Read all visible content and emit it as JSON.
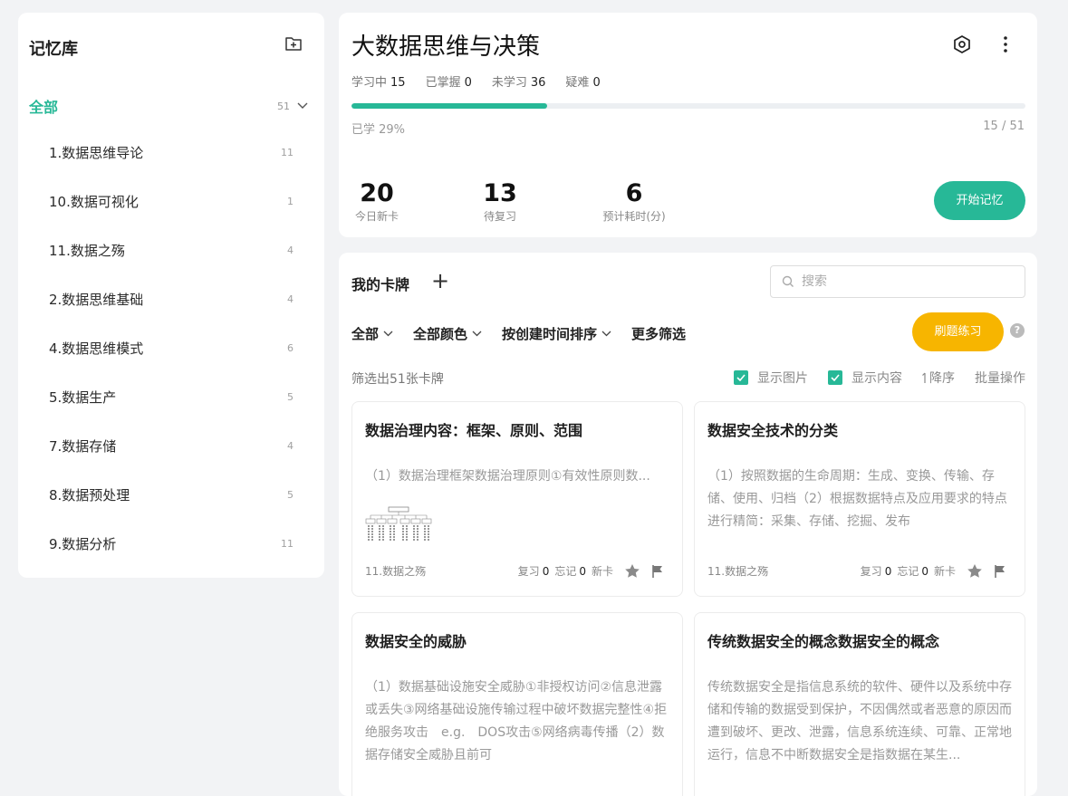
{
  "sidebar": {
    "title": "记忆库",
    "all": {
      "label": "全部",
      "count": "51"
    },
    "items": [
      {
        "label": "1.数据思维导论",
        "count": "11"
      },
      {
        "label": "10.数据可视化",
        "count": "1"
      },
      {
        "label": "11.数据之殇",
        "count": "4"
      },
      {
        "label": "2.数据思维基础",
        "count": "4"
      },
      {
        "label": "4.数据思维模式",
        "count": "6"
      },
      {
        "label": "5.数据生产",
        "count": "5"
      },
      {
        "label": "7.数据存储",
        "count": "4"
      },
      {
        "label": "8.数据预处理",
        "count": "5"
      },
      {
        "label": "9.数据分析",
        "count": "11"
      }
    ]
  },
  "deck": {
    "title": "大数据思维与决策",
    "stats": [
      {
        "label": "学习中",
        "value": "15"
      },
      {
        "label": "已掌握",
        "value": "0"
      },
      {
        "label": "未学习",
        "value": "36"
      },
      {
        "label": "疑难",
        "value": "0"
      }
    ],
    "progress_fraction": 0.29,
    "progress_label": "已学 29%",
    "progress_count": "15 / 51",
    "today_new": {
      "value": "20",
      "label": "今日新卡"
    },
    "to_review": {
      "value": "13",
      "label": "待复习"
    },
    "est_time": {
      "value": "6",
      "label": "预计耗时(分)"
    },
    "start_label": "开始记忆"
  },
  "cards_panel": {
    "title": "我的卡牌",
    "search_placeholder": "搜索",
    "filters": [
      "全部",
      "全部颜色",
      "按创建时间排序"
    ],
    "more_filters": "更多筛选",
    "practice_label": "刷题练习",
    "help": "?",
    "count_text": "筛选出51张卡牌",
    "show_image": "显示图片",
    "show_content": "显示内容",
    "sort_desc": "降序",
    "batch": "批量操作",
    "accent": "#27b897",
    "practice_color": "#f7b500"
  },
  "cards": [
    {
      "title": "数据治理内容：框架、原则、范围",
      "content": "（1）数据治理框架数据治理原则①有效性原则数...",
      "tag": "11.数据之殇",
      "review_label": "复习",
      "review": "0",
      "forget_label": "忘记",
      "forget": "0",
      "new_label": "新卡"
    },
    {
      "title": "数据安全技术的分类",
      "content": "（1）按照数据的生命周期：生成、变换、传输、存储、使用、归档（2）根据数据特点及应用要求的特点进行精简：采集、存储、挖掘、发布",
      "tag": "11.数据之殇",
      "review_label": "复习",
      "review": "0",
      "forget_label": "忘记",
      "forget": "0",
      "new_label": "新卡"
    },
    {
      "title": "数据安全的威胁",
      "content": "（1）数据基础设施安全威胁①非授权访问②信息泄露或丢失③网络基础设施传输过程中破坏数据完整性④拒绝服务攻击　e.g.　DOS攻击⑤网络病毒传播（2）数据存储安全威胁且前可"
    },
    {
      "title": "传统数据安全的概念数据安全的概念",
      "content": "传统数据安全是指信息系统的软件、硬件以及系统中存储和传输的数据受到保护，不因偶然或者恶意的原因而遭到破坏、更改、泄露，信息系统连续、可靠、正常地运行，信息不中断数据安全是指数据在某生..."
    }
  ]
}
